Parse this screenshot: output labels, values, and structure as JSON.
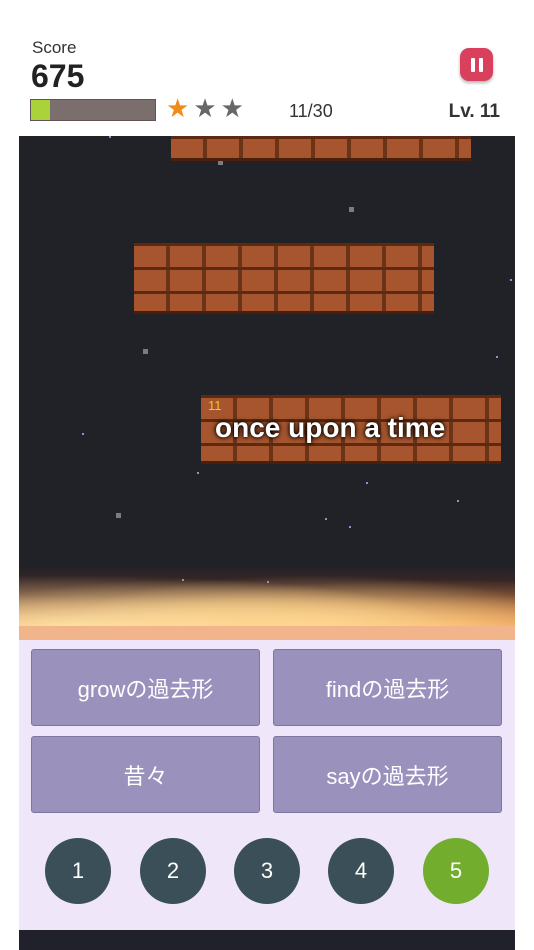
{
  "header": {
    "score_label": "Score",
    "score_value": "675",
    "progress_fraction": 0.15,
    "stars_earned": 1,
    "stars_total": 3,
    "question_counter": "11/30",
    "level": "Lv. 11"
  },
  "game": {
    "word_number": "11",
    "word_text": "once upon a time"
  },
  "answers": [
    {
      "label": "growの過去形"
    },
    {
      "label": "findの過去形"
    },
    {
      "label": "昔々"
    },
    {
      "label": "sayの過去形"
    }
  ],
  "numbers": [
    {
      "label": "1",
      "active": false
    },
    {
      "label": "2",
      "active": false
    },
    {
      "label": "3",
      "active": false
    },
    {
      "label": "4",
      "active": false
    },
    {
      "label": "5",
      "active": true
    }
  ],
  "icons": {
    "pause": "pause-icon",
    "star": "star-icon"
  },
  "colors": {
    "pause_button": "#d8405e",
    "star_on": "#f08c1c",
    "star_off": "#676767",
    "progress_fill": "#a9d23b",
    "answer_button": "#9a92bd",
    "number_button": "#3a4f57",
    "number_active": "#72ad2e",
    "brick": "#a6552e"
  }
}
